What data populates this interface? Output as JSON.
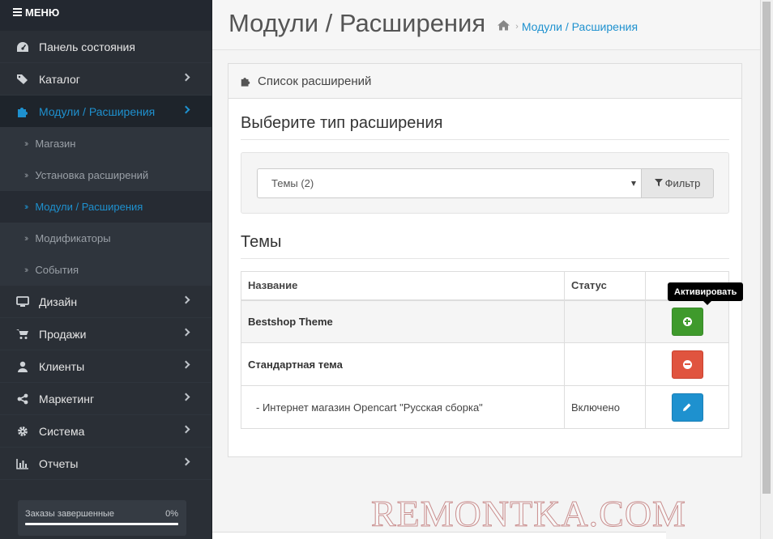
{
  "sidebar": {
    "menu_label": "МЕНЮ",
    "items": [
      {
        "label": "Панель состояния",
        "icon": "dashboard-icon"
      },
      {
        "label": "Каталог",
        "icon": "tags-icon"
      },
      {
        "label": "Модули / Расширения",
        "icon": "puzzle-icon"
      },
      {
        "label": "Дизайн",
        "icon": "monitor-icon"
      },
      {
        "label": "Продажи",
        "icon": "cart-icon"
      },
      {
        "label": "Клиенты",
        "icon": "user-icon"
      },
      {
        "label": "Маркетинг",
        "icon": "share-icon"
      },
      {
        "label": "Система",
        "icon": "gear-icon"
      },
      {
        "label": "Отчеты",
        "icon": "bar-chart-icon"
      }
    ],
    "subitems": [
      {
        "label": "Магазин"
      },
      {
        "label": "Установка расширений"
      },
      {
        "label": "Модули / Расширения"
      },
      {
        "label": "Модификаторы"
      },
      {
        "label": "События"
      }
    ],
    "progress": {
      "label": "Заказы завершенные",
      "value": "0%",
      "fraction": 0
    }
  },
  "header": {
    "title": "Модули / Расширения",
    "breadcrumb": "Модули / Расширения"
  },
  "panel": {
    "heading": "Список расширений",
    "choose_title": "Выберите тип расширения",
    "select_value": "Темы (2)",
    "filter_label": "Фильтр",
    "section_title": "Темы",
    "table": {
      "col_name": "Название",
      "col_status": "Статус",
      "rows": [
        {
          "name": "Bestshop Theme",
          "status": ""
        },
        {
          "name": "Стандартная тема",
          "status": ""
        },
        {
          "name": "-   Интернет магазин Opencart \"Русская сборка\"",
          "status": "Включено"
        }
      ]
    },
    "tooltip": "Активировать"
  },
  "colors": {
    "accent": "#1e91cf",
    "success": "#3f9a2c",
    "danger": "#e0543f",
    "sidebar": "#2a2f36"
  },
  "watermark": "REMONTKA.COM"
}
